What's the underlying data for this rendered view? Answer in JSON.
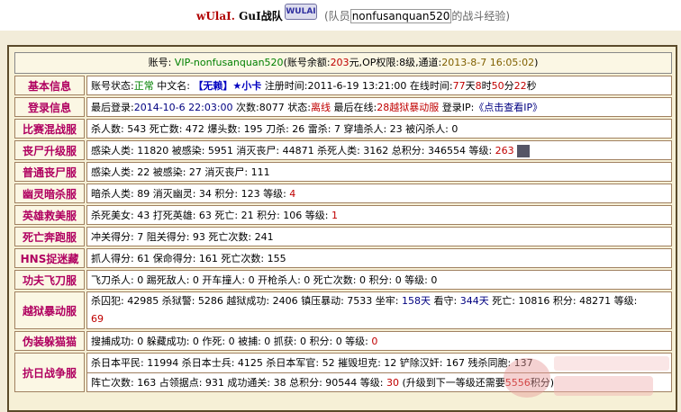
{
  "header": {
    "brand_prefix": "wUlaI.",
    "brand_main": "GuI",
    "brand_suffix": "战队",
    "logo_text": "WULAI",
    "member_prefix": "(队员",
    "member_name": "nonfusanquan520",
    "member_suffix": "的战斗经验)"
  },
  "account": {
    "label": "账号:",
    "name": "VIP-nonfusanquan520",
    "balance_label": "(账号余额:",
    "balance": "203",
    "balance_unit": "元,",
    "op_label": "OP权限:",
    "op": "8级",
    "channel_label": ",通道:",
    "date": "2013-8-7 16:05:02",
    "close": ")"
  },
  "rows": [
    {
      "label": "基本信息"
    },
    {
      "label": "登录信息"
    },
    {
      "label": "比赛混战服"
    },
    {
      "label": "丧尸升级服"
    },
    {
      "label": "普通丧尸服"
    },
    {
      "label": "幽灵暗杀服"
    },
    {
      "label": "英雄救美服"
    },
    {
      "label": "死亡奔跑服"
    },
    {
      "label": "HNS捉迷藏"
    },
    {
      "label": "功夫飞刀服"
    },
    {
      "label": "越狱暴动服"
    },
    {
      "label": "伪装躲猫猫"
    },
    {
      "label": "抗日战争服"
    }
  ],
  "basic": {
    "status_label": "账号状态:",
    "status": "正常",
    "cn_label": "中文名:",
    "cn_name": "【无赖】★小卡",
    "reg_label": "注册时间:",
    "reg_time": "2011-6-19 13:21:00",
    "online_label": "在线时间:",
    "online_days": "77",
    "online_hours": "8",
    "online_mins": "50",
    "online_secs": "22"
  },
  "login": {
    "last_label": "最后登录:",
    "last": "2014-10-6 22:03:00",
    "count_label": "次数:",
    "count": "8077",
    "state_label": "状态:",
    "state": "离线",
    "last_online_label": "最后在线:",
    "last_online": "28越狱暴动服",
    "ip_label": "登录IP:",
    "ip": "《点击查看IP》"
  },
  "mix": "杀人数: 543  死亡数: 472  爆头数: 195  刀杀: 26  雷杀: 7  穿墙杀人: 23  被闪杀人: 0",
  "zombie_up": "感染人类: 11820  被感染: 5951  消灭丧尸: 44871  杀死人类: 3162  总积分: 346554  等级:",
  "zombie_up_level": "263",
  "zombie_normal": "感染人类: 22  被感染: 27  消灭丧尸: 111",
  "ghost": "暗杀人类: 89  消灭幽灵: 34  积分: 123  等级:",
  "ghost_level": "4",
  "hero": "杀死美女: 43  打死英雄: 63  死亡: 21  积分: 106  等级:",
  "hero_level": "1",
  "run": "冲关得分: 7  阻关得分: 93  死亡次数: 241",
  "hns": "抓人得分: 61  保命得分: 161  死亡次数: 155",
  "knife": "飞刀杀人: 0  踢死敌人: 0  开车撞人: 0  开枪杀人: 0  死亡次数: 0  积分: 0  等级: 0",
  "jail": {
    "text1": "杀囚犯: 42985  杀狱警: 5286  越狱成功: 2406  镇压暴动: 7533  坐牢:",
    "prison_days": "158天",
    "text2": "看守:",
    "guard_days": "344天",
    "text3": "死亡: 10816  积分: 48271  等级:",
    "level": "69"
  },
  "hide": "搜捕成功: 0  躲藏成功: 0  作死: 0  被捕: 0  抓获: 0  积分: 0  等级:",
  "hide_level": "0",
  "war": {
    "line1": "杀日本平民: 11994  杀日本士兵: 4125  杀日本军官: 52  摧毁坦克: 12  铲除汉奸: 167  残杀同胞: 137",
    "line2a": "阵亡次数: 163  占领据点: 931  成功通关: 38  总积分: 90544  等级:",
    "level": "30",
    "line2b": "(升级到下一等级还需要",
    "need": "5556",
    "line2c": "积分)"
  }
}
